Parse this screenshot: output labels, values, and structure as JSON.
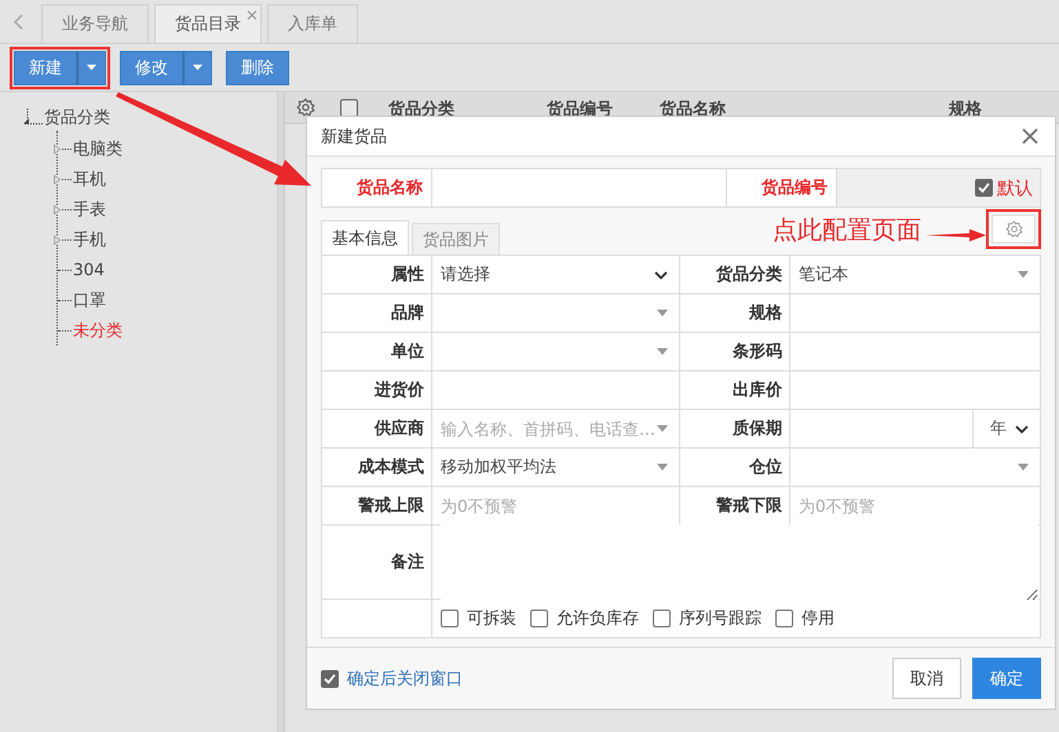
{
  "nav_tabs": [
    {
      "label": "业务导航",
      "selected": false,
      "closable": false
    },
    {
      "label": "货品目录",
      "selected": true,
      "closable": true
    },
    {
      "label": "入库单",
      "selected": false,
      "closable": false
    }
  ],
  "toolbar": [
    {
      "label": "新建",
      "dropdown": true,
      "highlighted": true
    },
    {
      "label": "修改",
      "dropdown": true,
      "highlighted": false
    },
    {
      "label": "删除",
      "dropdown": false,
      "highlighted": false
    }
  ],
  "tree": {
    "label": "货品分类",
    "children": [
      {
        "label": "电脑类",
        "has_children": true,
        "selected": false
      },
      {
        "label": "耳机",
        "has_children": true,
        "selected": false
      },
      {
        "label": "手表",
        "has_children": true,
        "selected": false
      },
      {
        "label": "手机",
        "has_children": true,
        "selected": false
      },
      {
        "label": "304",
        "has_children": false,
        "selected": false
      },
      {
        "label": "口罩",
        "has_children": false,
        "selected": false
      },
      {
        "label": "未分类",
        "has_children": false,
        "selected": true
      }
    ]
  },
  "grid": {
    "select_all_checked": false,
    "columns": [
      "货品分类",
      "货品编号",
      "货品名称",
      "规格"
    ]
  },
  "dialog": {
    "title": "新建货品",
    "header_fields": [
      {
        "label": "货品名称",
        "required": true
      },
      {
        "label": "货品编号",
        "required": true
      }
    ],
    "default_option": {
      "label": "默认",
      "checked": true
    },
    "tabs": [
      {
        "label": "基本信息",
        "selected": true
      },
      {
        "label": "货品图片",
        "selected": false
      }
    ],
    "annotation": "点此配置页面",
    "fields": [
      {
        "label": "属性",
        "kind": "select",
        "value": "请选择"
      },
      {
        "label": "货品分类",
        "kind": "combo",
        "value": "笔记本"
      },
      {
        "label": "品牌",
        "kind": "combo"
      },
      {
        "label": "规格",
        "kind": "text"
      },
      {
        "label": "单位",
        "kind": "combo"
      },
      {
        "label": "条形码",
        "kind": "text"
      },
      {
        "label": "进货价",
        "kind": "text"
      },
      {
        "label": "出库价",
        "kind": "text"
      },
      {
        "label": "供应商",
        "kind": "combo",
        "placeholder": "输入名称、首拼码、电话查…"
      },
      {
        "label": "质保期",
        "kind": "unit",
        "unit": "年"
      },
      {
        "label": "成本模式",
        "kind": "combo",
        "value": "移动加权平均法"
      },
      {
        "label": "仓位",
        "kind": "combo"
      },
      {
        "label": "警戒上限",
        "kind": "text",
        "placeholder": "为0不预警"
      },
      {
        "label": "警戒下限",
        "kind": "text",
        "placeholder": "为0不预警"
      }
    ],
    "remark_label": "备注",
    "options": [
      {
        "label": "可拆装",
        "checked": false
      },
      {
        "label": "允许负库存",
        "checked": false
      },
      {
        "label": "序列号跟踪",
        "checked": false
      },
      {
        "label": "停用",
        "checked": false
      }
    ],
    "close_after_confirm": {
      "label": "确定后关闭窗口",
      "checked": true
    },
    "buttons": [
      {
        "label": "取消",
        "kind": "default"
      },
      {
        "label": "确定",
        "kind": "primary"
      }
    ]
  }
}
